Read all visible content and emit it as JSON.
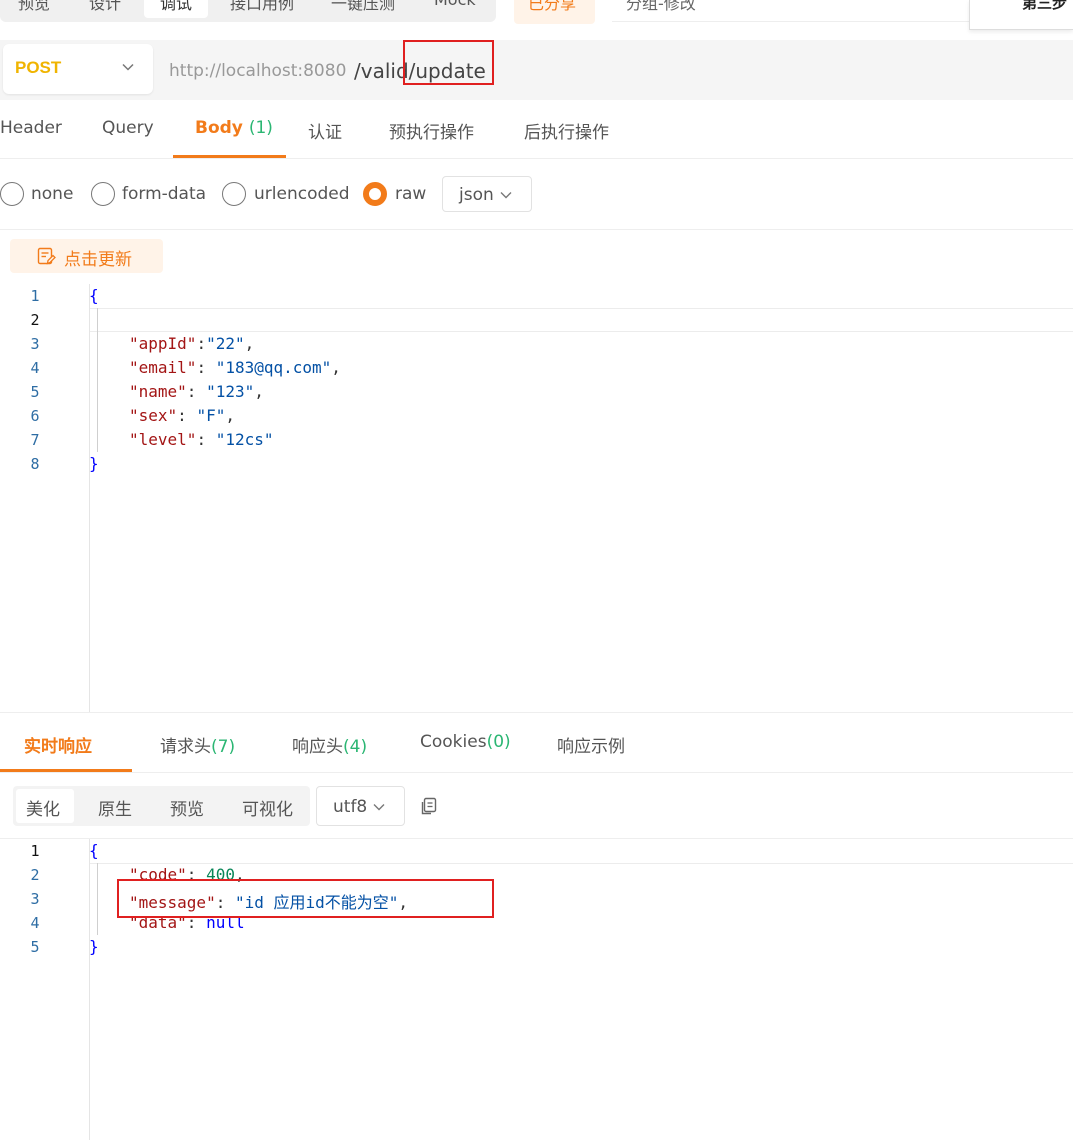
{
  "top": {
    "tabs": [
      "预览",
      "设计",
      "调试",
      "接口用例",
      "一键压测",
      "Mock"
    ],
    "active_tab": "调试",
    "share_label": "已分享",
    "name_value": "分组-修改",
    "step_label": "第三步"
  },
  "request": {
    "method": "POST",
    "base_url": "http://localhost:8080",
    "path": "/valid/update"
  },
  "request_tabs": {
    "header": "Header",
    "query": "Query",
    "body": "Body",
    "body_count": "(1)",
    "auth": "认证",
    "pre": "预执行操作",
    "post": "后执行操作"
  },
  "body_types": {
    "none": "none",
    "form_data": "form-data",
    "urlencoded": "urlencoded",
    "raw": "raw",
    "selected": "raw",
    "format": "json"
  },
  "update_button": "点击更新",
  "request_body": {
    "line_numbers": [
      "1",
      "2",
      "3",
      "4",
      "5",
      "6",
      "7",
      "8"
    ],
    "open": "{",
    "close": "}",
    "fields": [
      {
        "key": "\"appId\"",
        "sep": ":",
        "value": "\"22\"",
        "end": ","
      },
      {
        "key": "\"email\"",
        "sep": ": ",
        "value": "\"183@qq.com\"",
        "end": ","
      },
      {
        "key": "\"name\"",
        "sep": ": ",
        "value": "\"123\"",
        "end": ","
      },
      {
        "key": "\"sex\"",
        "sep": ": ",
        "value": "\"F\"",
        "end": ","
      },
      {
        "key": "\"level\"",
        "sep": ": ",
        "value": "\"12cs\"",
        "end": ""
      }
    ]
  },
  "response_tabs": {
    "live": "实时响应",
    "req_headers": "请求头",
    "req_headers_count": "(7)",
    "resp_headers": "响应头",
    "resp_headers_count": "(4)",
    "cookies": "Cookies",
    "cookies_count": "(0)",
    "example": "响应示例"
  },
  "response_view": {
    "pretty": "美化",
    "raw": "原生",
    "preview": "预览",
    "visual": "可视化",
    "encoding": "utf8"
  },
  "response_body": {
    "line_numbers": [
      "1",
      "2",
      "3",
      "4",
      "5"
    ],
    "open": "{",
    "close": "}",
    "code_key": "\"code\"",
    "code_value": "400",
    "message_key": "\"message\"",
    "message_value": "\"id 应用id不能为空\"",
    "data_key": "\"data\"",
    "data_value": "null"
  },
  "colors": {
    "accent": "#f27b1a",
    "count": "#2bb673",
    "method": "#f0b400",
    "highlight": "#e02020"
  }
}
